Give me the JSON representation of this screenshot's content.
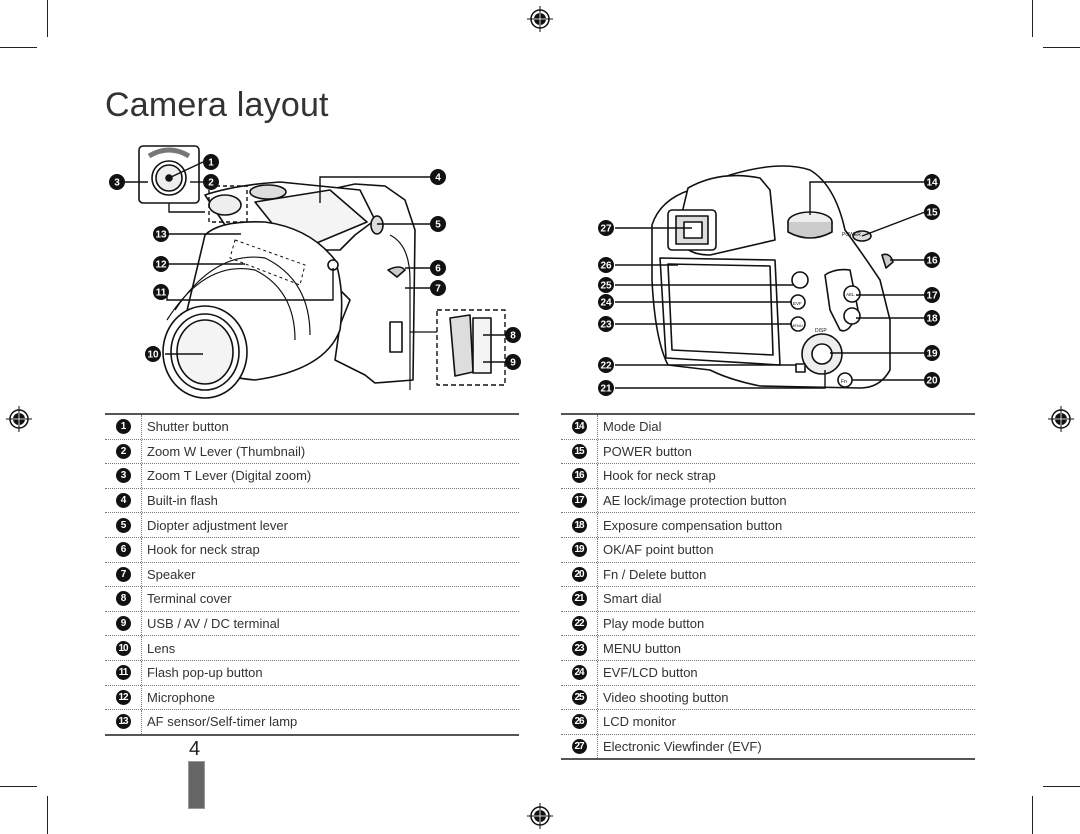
{
  "page": {
    "title": "Camera layout",
    "page_number": "4"
  },
  "front_view": {
    "callouts": [
      "1",
      "2",
      "3",
      "4",
      "5",
      "6",
      "7",
      "8",
      "9",
      "10",
      "11",
      "12",
      "13"
    ]
  },
  "back_view": {
    "callouts": [
      "14",
      "15",
      "16",
      "17",
      "18",
      "19",
      "20",
      "21",
      "22",
      "23",
      "24",
      "25",
      "26",
      "27"
    ]
  },
  "legend_left": [
    {
      "num": "1",
      "label": "Shutter button"
    },
    {
      "num": "2",
      "label": "Zoom W Lever (Thumbnail)"
    },
    {
      "num": "3",
      "label": "Zoom T Lever (Digital zoom)"
    },
    {
      "num": "4",
      "label": "Built-in flash"
    },
    {
      "num": "5",
      "label": "Diopter adjustment lever"
    },
    {
      "num": "6",
      "label": "Hook for neck strap"
    },
    {
      "num": "7",
      "label": "Speaker"
    },
    {
      "num": "8",
      "label": "Terminal cover"
    },
    {
      "num": "9",
      "label": "USB / AV / DC terminal"
    },
    {
      "num": "10",
      "label": "Lens"
    },
    {
      "num": "11",
      "label": "Flash pop-up button"
    },
    {
      "num": "12",
      "label": "Microphone"
    },
    {
      "num": "13",
      "label": "AF sensor/Self-timer lamp"
    }
  ],
  "legend_right": [
    {
      "num": "14",
      "label": "Mode Dial"
    },
    {
      "num": "15",
      "label": "POWER button"
    },
    {
      "num": "16",
      "label": "Hook for neck strap"
    },
    {
      "num": "17",
      "label": "AE lock/image protection button"
    },
    {
      "num": "18",
      "label": "Exposure compensation button"
    },
    {
      "num": "19",
      "label": "OK/AF point button"
    },
    {
      "num": "20",
      "label": "Fn / Delete button"
    },
    {
      "num": "21",
      "label": "Smart dial"
    },
    {
      "num": "22",
      "label": "Play mode button"
    },
    {
      "num": "23",
      "label": "MENU button"
    },
    {
      "num": "24",
      "label": "EVF/LCD button"
    },
    {
      "num": "25",
      "label": "Video shooting button"
    },
    {
      "num": "26",
      "label": "LCD monitor"
    },
    {
      "num": "27",
      "label": "Electronic Viewfinder (EVF)"
    }
  ],
  "labels": {
    "power": "POWER",
    "evf": "EVF",
    "menu": "MENU",
    "disp": "DISP",
    "fn": "Fn",
    "ael": "AEL"
  }
}
